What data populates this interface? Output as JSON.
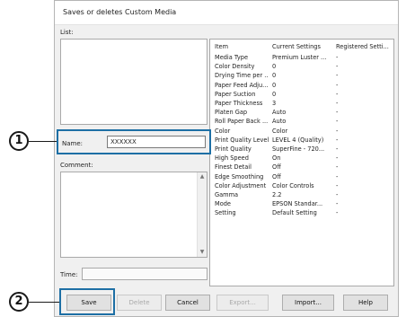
{
  "dialog": {
    "title": "Saves or deletes Custom Media"
  },
  "list": {
    "label": "List:"
  },
  "name": {
    "label": "Name:",
    "value": "XXXXXX"
  },
  "comment": {
    "label": "Comment:"
  },
  "time": {
    "label": "Time:",
    "value": ""
  },
  "settings_table": {
    "headers": [
      "Item",
      "Current Settings",
      "Registered Setti..."
    ],
    "rows": [
      [
        "Media Type",
        "Premium Luster ...",
        "-"
      ],
      [
        "Color Density",
        "0",
        "-"
      ],
      [
        "Drying Time per ...",
        "0",
        "-"
      ],
      [
        "Paper Feed Adju...",
        "0",
        "-"
      ],
      [
        "Paper Suction",
        "0",
        "-"
      ],
      [
        "Paper Thickness",
        "3",
        "-"
      ],
      [
        "Platen Gap",
        "Auto",
        "-"
      ],
      [
        "Roll Paper Back ...",
        "Auto",
        "-"
      ],
      [
        "Color",
        "Color",
        "-"
      ],
      [
        "Print Quality Level",
        "LEVEL 4 (Quality)",
        "-"
      ],
      [
        "Print Quality",
        "SuperFine - 720...",
        "-"
      ],
      [
        "High Speed",
        "On",
        "-"
      ],
      [
        "Finest Detail",
        "Off",
        "-"
      ],
      [
        "Edge Smoothing",
        "Off",
        "-"
      ],
      [
        "Color Adjustment",
        "Color Controls",
        "-"
      ],
      [
        "Gamma",
        "2.2",
        "-"
      ],
      [
        "Mode",
        "EPSON Standar...",
        "-"
      ],
      [
        "Setting",
        "Default Setting",
        "-"
      ]
    ]
  },
  "buttons": {
    "save": "Save",
    "delete": "Delete",
    "cancel": "Cancel",
    "export": "Export...",
    "import": "Import...",
    "help": "Help"
  },
  "callouts": {
    "step1": "1",
    "step2": "2"
  },
  "colors": {
    "highlight": "#1d6fa5"
  }
}
